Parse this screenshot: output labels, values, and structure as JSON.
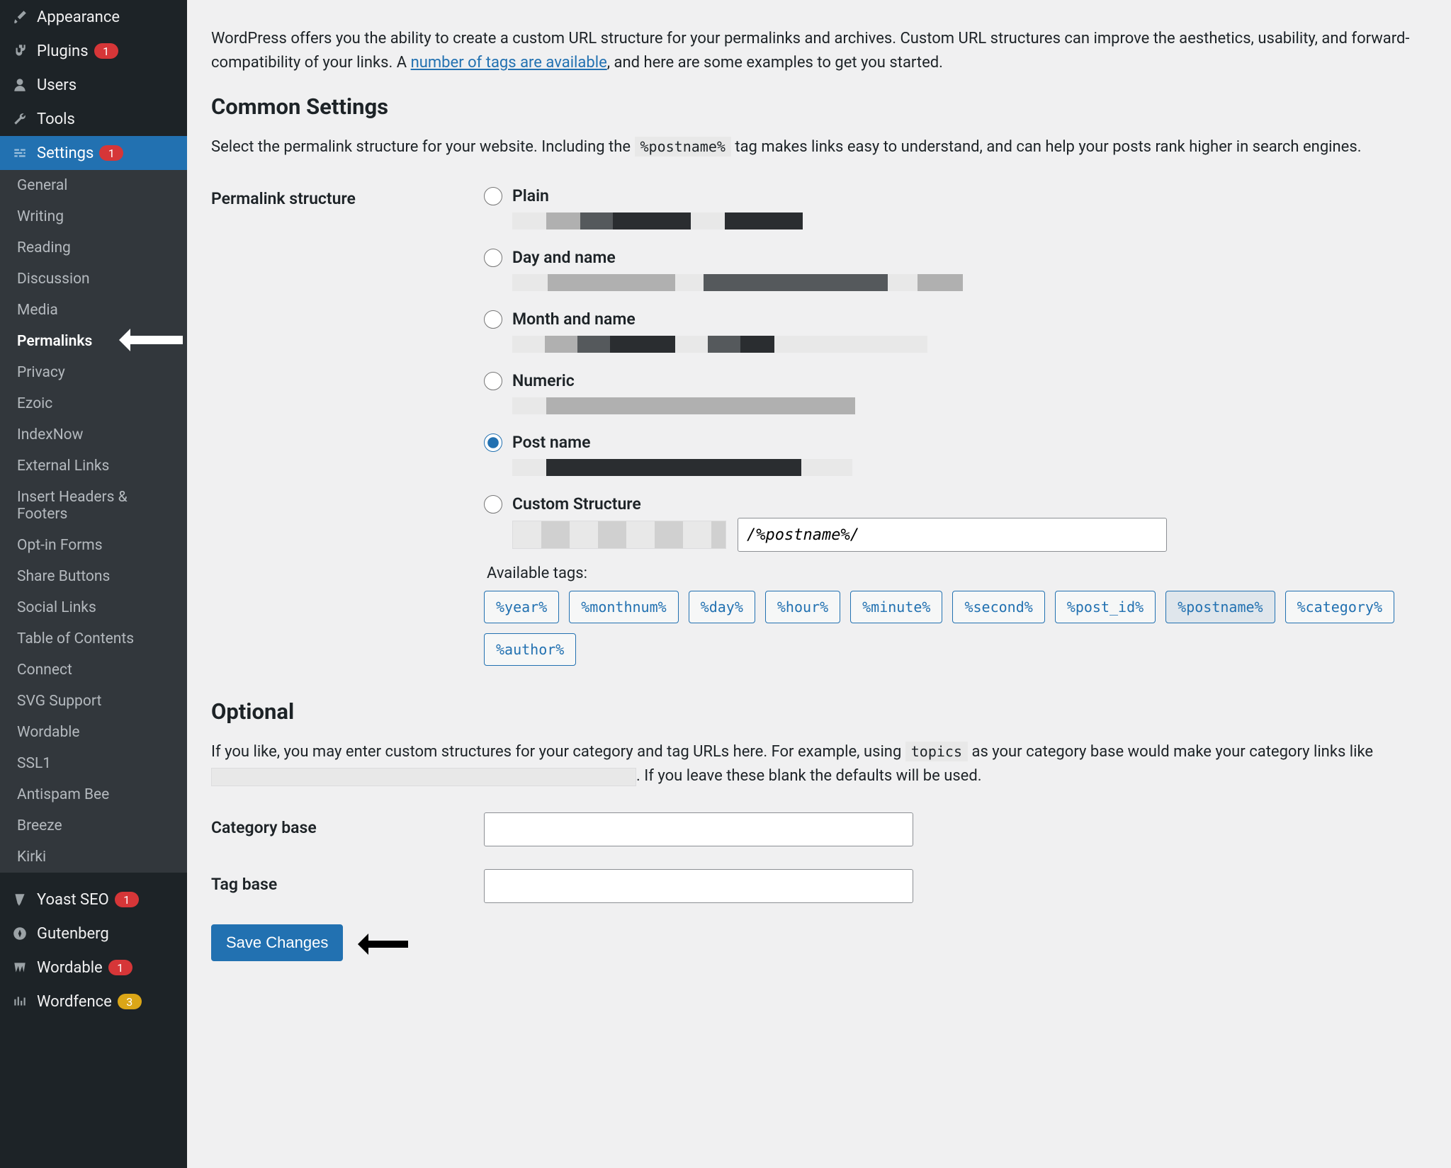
{
  "sidebar": {
    "items": [
      {
        "label": "Appearance",
        "icon": "brush-icon",
        "badge": null
      },
      {
        "label": "Plugins",
        "icon": "plugin-icon",
        "badge": "1"
      },
      {
        "label": "Users",
        "icon": "user-icon",
        "badge": null
      },
      {
        "label": "Tools",
        "icon": "wrench-icon",
        "badge": null
      },
      {
        "label": "Settings",
        "icon": "sliders-icon",
        "badge": "1",
        "active": true
      }
    ],
    "settings_submenu": [
      "General",
      "Writing",
      "Reading",
      "Discussion",
      "Media",
      "Permalinks",
      "Privacy",
      "Ezoic",
      "IndexNow",
      "External Links",
      "Insert Headers & Footers",
      "Opt-in Forms",
      "Share Buttons",
      "Social Links",
      "Table of Contents",
      "Connect",
      "SVG Support",
      "Wordable",
      "SSL",
      "Antispam Bee",
      "Breeze",
      "Kirki"
    ],
    "settings_submenu_current": "Permalinks",
    "settings_submenu_badges": {
      "SSL": "1"
    },
    "bottom_items": [
      {
        "label": "Yoast SEO",
        "icon": "yoast-icon",
        "badge": "1",
        "badge_color": "red"
      },
      {
        "label": "Gutenberg",
        "icon": "gutenberg-icon",
        "badge": null
      },
      {
        "label": "Wordable",
        "icon": "wordable-icon",
        "badge": "1",
        "badge_color": "red"
      },
      {
        "label": "Wordfence",
        "icon": "wordfence-icon",
        "badge": "3",
        "badge_color": "orange"
      }
    ]
  },
  "intro": {
    "text1": "WordPress offers you the ability to create a custom URL structure for your permalinks and archives. Custom URL structures can improve the aesthetics, usability, and forward-compatibility of your links. A ",
    "link": "number of tags are available",
    "text2": ", and here are some examples to get you started."
  },
  "common": {
    "heading": "Common Settings",
    "desc_pre": "Select the permalink structure for your website. Including the ",
    "code": "%postname%",
    "desc_post": " tag makes links easy to understand, and can help your posts rank higher in search engines.",
    "row_label": "Permalink structure",
    "options": [
      {
        "key": "plain",
        "label": "Plain"
      },
      {
        "key": "day-name",
        "label": "Day and name"
      },
      {
        "key": "month-name",
        "label": "Month and name"
      },
      {
        "key": "numeric",
        "label": "Numeric"
      },
      {
        "key": "post-name",
        "label": "Post name"
      },
      {
        "key": "custom",
        "label": "Custom Structure"
      }
    ],
    "selected": "post-name",
    "custom_value": "/%postname%/",
    "tags_label": "Available tags:",
    "tags": [
      "%year%",
      "%monthnum%",
      "%day%",
      "%hour%",
      "%minute%",
      "%second%",
      "%post_id%",
      "%postname%",
      "%category%",
      "%author%"
    ],
    "tags_selected": [
      "%postname%"
    ]
  },
  "optional": {
    "heading": "Optional",
    "text_pre": "If you like, you may enter custom structures for your category and tag URLs here. For example, using ",
    "code": "topics",
    "text_mid": " as your category base would make your category links like ",
    "text_post": ". If you leave these blank the defaults will be used.",
    "category_label": "Category base",
    "tag_label": "Tag base",
    "category_value": "",
    "tag_value": ""
  },
  "save_label": "Save Changes"
}
